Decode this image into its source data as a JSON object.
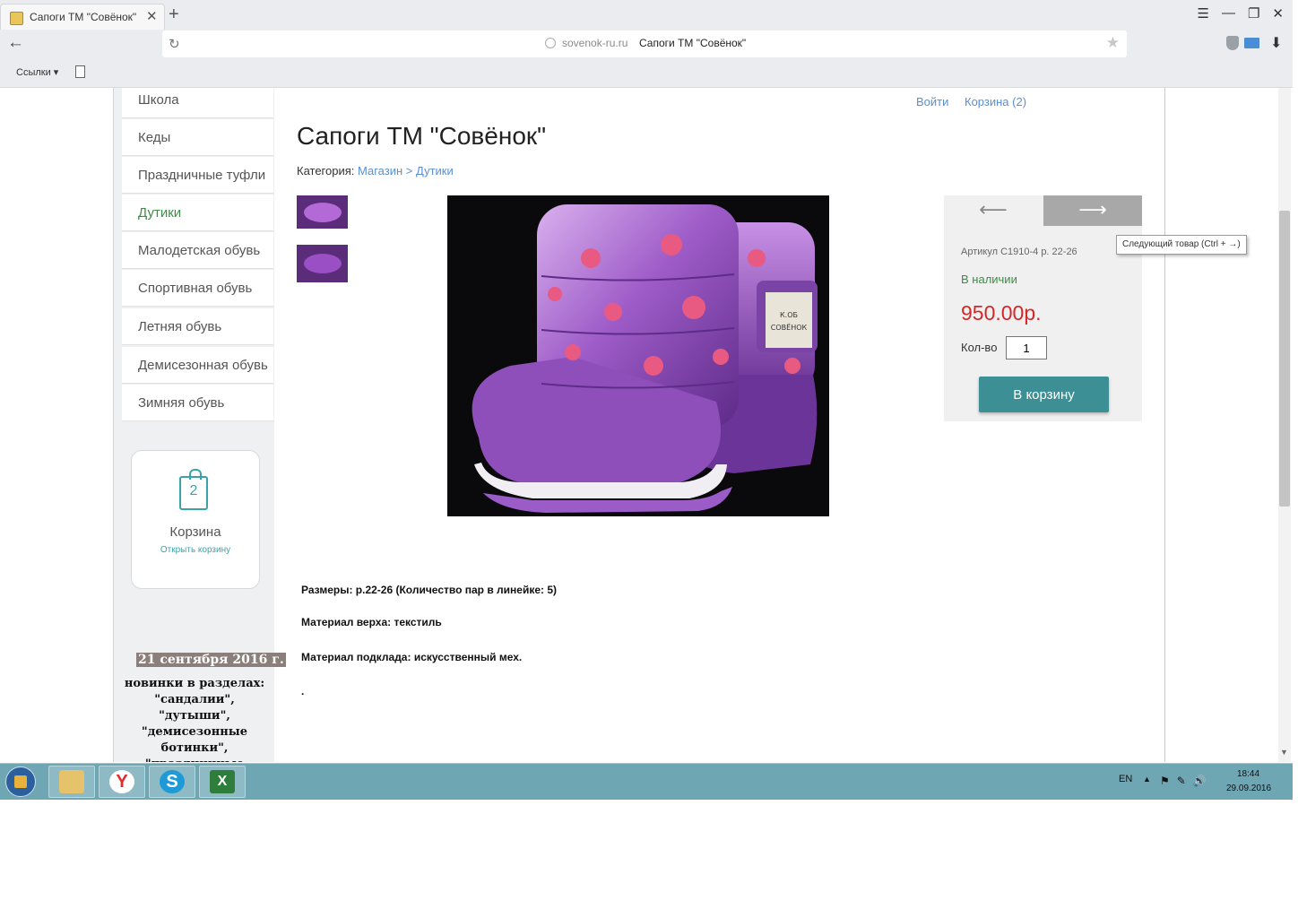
{
  "browser": {
    "tab_title": "Сапоги ТМ \"Совёнок\"",
    "tab_close": "✕",
    "new_tab": "+",
    "window_controls": [
      "☰",
      "—",
      "❐",
      "✕"
    ],
    "back": "←",
    "reload": "↻",
    "address_host": "sovenok-ru.ru",
    "address_title": "Сапоги ТМ \"Совёнок\"",
    "bookmark_star": "★",
    "download": "⬇",
    "bookmarks_links": "Ссылки ▾",
    "icons": [
      "shield-icon",
      "mail-icon",
      "download-icon",
      "document-icon"
    ]
  },
  "sidebar": {
    "items": [
      {
        "label": "Школа"
      },
      {
        "label": "Кеды"
      },
      {
        "label": "Праздничные туфли"
      },
      {
        "label": "Дутики"
      },
      {
        "label": "Малодетская обувь"
      },
      {
        "label": "Спортивная обувь"
      },
      {
        "label": "Летняя обувь"
      },
      {
        "label": "Демисезонная обувь"
      },
      {
        "label": "Зимняя обувь"
      }
    ],
    "active_item": "Дутики",
    "cart": {
      "count": "2",
      "label": "Корзина",
      "open_link": "Открыть корзину"
    },
    "news": {
      "date": "21 сентября 2016 г.",
      "text": "новинки в разделах: \"сандалии\", \"дутыши\", \"демисезонные ботинки\", \"праздничные туфли\","
    }
  },
  "header": {
    "login": "Войти",
    "cart": "Корзина (2)"
  },
  "product": {
    "title": "Сапоги ТМ \"Совёнок\"",
    "category_label": "Категория: ",
    "category_path": [
      "Магазин",
      "Дутики"
    ],
    "category_sep": " > ",
    "prev_arrow": "⟵",
    "next_arrow": "⟶",
    "next_tooltip": "Следующий товар (Ctrl + →)",
    "sku": "Артикул С1910-4 р. 22-26",
    "availability": "В наличии",
    "price": "950.00р.",
    "qty_label": "Кол-во",
    "qty_value": "1",
    "add_to_cart": "В корзину",
    "description": [
      "Размеры: р.22-26 (Количество пар в линейке: 5)",
      "Материал верха: текстиль",
      "Материал подклада: искусственный мех.",
      "."
    ],
    "label_text": "К.ОБ 1990 СОВЁНОК"
  },
  "taskbar": {
    "apps": [
      "Y",
      "S",
      "X"
    ],
    "lang": "EN",
    "tray_up": "▲",
    "tray_icons": [
      "⚑",
      "✎",
      "🔊"
    ],
    "time": "18:44",
    "date": "29.09.2016"
  },
  "colors": {
    "accent_teal": "#3c8f94",
    "link_blue": "#5a8fd1",
    "price_red": "#d42828",
    "stock_green": "#3d8c47",
    "taskbar": "#6fa6b3"
  }
}
